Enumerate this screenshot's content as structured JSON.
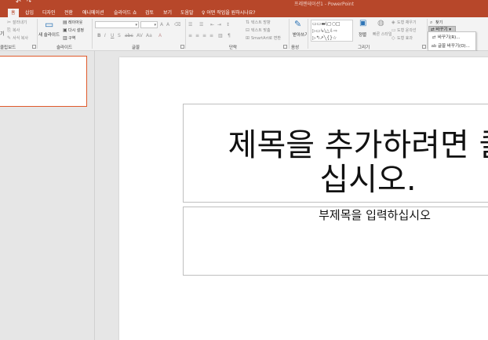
{
  "titlebar": {
    "title": "프레젠테이션1 - PowerPoint"
  },
  "tabs": [
    {
      "label": "홈",
      "active": true
    },
    {
      "label": "삽입"
    },
    {
      "label": "디자인"
    },
    {
      "label": "전환"
    },
    {
      "label": "애니메이션"
    },
    {
      "label": "슬라이드 쇼"
    },
    {
      "label": "검토"
    },
    {
      "label": "보기"
    },
    {
      "label": "도움말"
    }
  ],
  "tellme": "어떤 작업을 원하시나요?",
  "ribbon": {
    "clipboard": {
      "cut": "잘라내기",
      "copy": "복사",
      "format_painter": "서식 복사",
      "paste_partial": "기",
      "label": "클립보드"
    },
    "slides": {
      "new_slide": "새 슬라이드",
      "layout": "레이아웃",
      "reset": "다시 설정",
      "section": "구역",
      "label": "슬라이드"
    },
    "font": {
      "label": "글꼴"
    },
    "paragraph": {
      "text_direction": "텍스트 방향",
      "align_text": "텍스트 맞춤",
      "smartart": "SmartArt로 변환",
      "label": "단락"
    },
    "voice": {
      "dictate": "받아쓰기",
      "label": "음성"
    },
    "drawing": {
      "arrange": "정렬",
      "quick_styles": "빠른 스타일",
      "shape_fill": "도형 채우기",
      "shape_outline": "도형 윤곽선",
      "shape_effects": "도형 효과",
      "label": "그리기"
    },
    "editing": {
      "find": "찾기",
      "replace": "바꾸기"
    }
  },
  "replace_menu": {
    "items": [
      {
        "label": "바꾸기(R)..."
      },
      {
        "label": "글꼴 바꾸기(O)..."
      }
    ]
  },
  "slide": {
    "title_placeholder": "제목을 추가하려면 클릭하십시오.",
    "title_line1": "제목을 추가하려면 클",
    "title_line2": "십시오.",
    "subtitle_placeholder": "부제목을 입력하십시오"
  }
}
